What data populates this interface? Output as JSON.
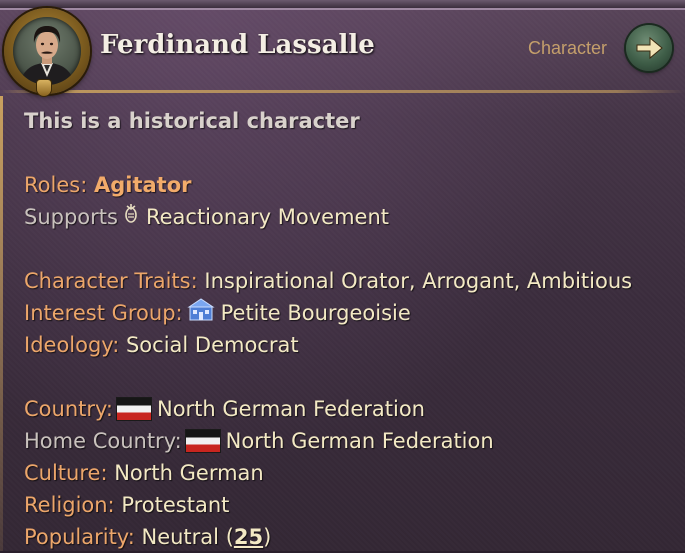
{
  "character": {
    "name": "Ferdinand Lassalle",
    "link_label": "Character",
    "historical_note": "This is a historical character"
  },
  "details": {
    "roles_label": "Roles:",
    "roles_value": "Agitator",
    "supports_label": "Supports",
    "supports_value": "Reactionary Movement",
    "traits_label": "Character Traits:",
    "traits_value": "Inspirational Orator, Arrogant, Ambitious",
    "interest_group_label": "Interest Group:",
    "interest_group_value": "Petite Bourgeoisie",
    "ideology_label": "Ideology:",
    "ideology_value": "Social Democrat",
    "country_label": "Country:",
    "country_value": "North German Federation",
    "home_country_label": "Home Country:",
    "home_country_value": "North German Federation",
    "culture_label": "Culture:",
    "culture_value": "North German",
    "religion_label": "Religion:",
    "religion_value": "Protestant",
    "popularity_label": "Popularity:",
    "popularity_value": "Neutral",
    "popularity_open": "(",
    "popularity_number": "25",
    "popularity_close": ")"
  },
  "icons": {
    "portrait": "character-portrait",
    "arrow": "arrow-right-icon",
    "movement": "movement-icon",
    "interest_group": "petite-bourgeoisie-icon",
    "flag": "north-german-federation-flag"
  },
  "colors": {
    "label": "#eca66a",
    "value": "#f3e9c4",
    "muted_label": "#c9c2bd",
    "panel_bg": "#3a2c3c",
    "gold_trim": "#c9a15f"
  }
}
